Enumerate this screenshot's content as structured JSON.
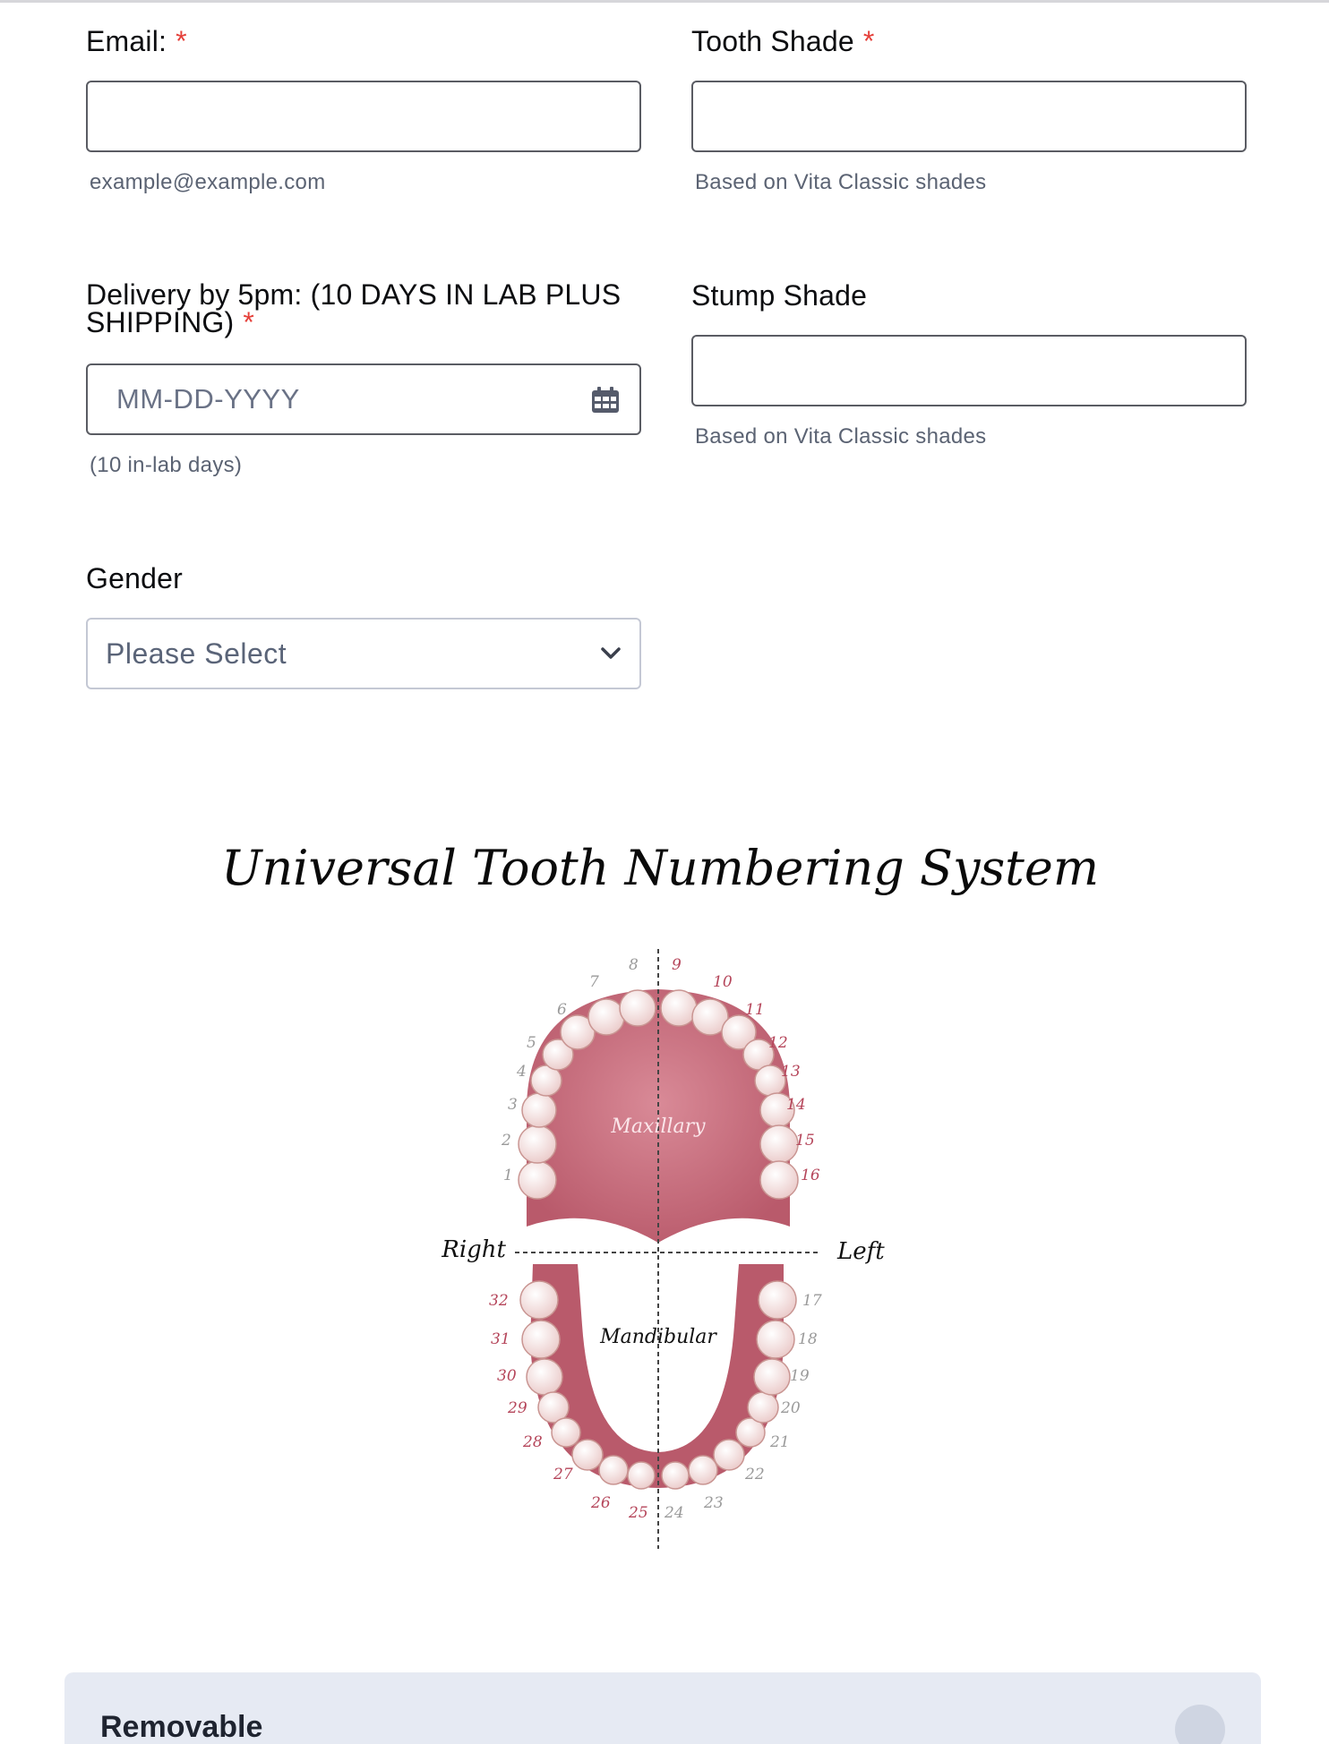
{
  "form": {
    "email": {
      "label": "Email:",
      "required": "*",
      "value": "",
      "sublabel": "example@example.com"
    },
    "tooth_shade": {
      "label": "Tooth Shade",
      "required": "*",
      "value": "",
      "sublabel": "Based on Vita Classic shades"
    },
    "delivery": {
      "label_line1": "Delivery by 5pm: (10 DAYS IN LAB PLUS",
      "label_line2": "SHIPPING)",
      "required": "*",
      "placeholder": "MM-DD-YYYY",
      "sublabel": "(10 in-lab days)",
      "icon": "calendar-icon"
    },
    "stump_shade": {
      "label": "Stump Shade",
      "value": "",
      "sublabel": "Based on Vita Classic shades"
    },
    "gender": {
      "label": "Gender",
      "selected": "Please Select",
      "icon": "chevron-down-icon"
    }
  },
  "diagram": {
    "title": "Universal Tooth Numbering System",
    "upper_label": "Maxillary",
    "lower_label": "Mandibular",
    "right_label": "Right",
    "left_label": "Left",
    "numbers": [
      "1",
      "2",
      "3",
      "4",
      "5",
      "6",
      "7",
      "8",
      "9",
      "10",
      "11",
      "12",
      "13",
      "14",
      "15",
      "16",
      "17",
      "18",
      "19",
      "20",
      "21",
      "22",
      "23",
      "24",
      "25",
      "26",
      "27",
      "28",
      "29",
      "30",
      "31",
      "32"
    ],
    "colors": {
      "gum": "#b95a6b",
      "gum_light": "#d98a97",
      "highlight_number": "#b5455a",
      "muted_number": "#9a9a9a",
      "tooth": "#f6e3e2"
    }
  },
  "section": {
    "label": "Removable",
    "icon": "collapse-toggle-icon"
  },
  "colors": {
    "required": "#e5403a",
    "input_border": "#5a5c63",
    "select_border": "#c4c8d4",
    "section_bg": "#e6eaf3"
  }
}
